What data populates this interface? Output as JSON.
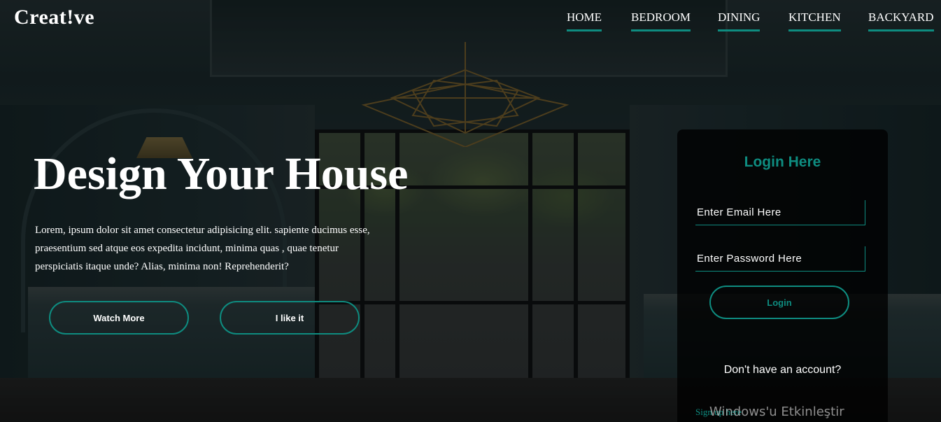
{
  "brand": "Creat!ve",
  "nav": {
    "items": [
      {
        "label": "HOME"
      },
      {
        "label": "BEDROOM"
      },
      {
        "label": "DINING"
      },
      {
        "label": "KITCHEN"
      },
      {
        "label": "BACKYARD"
      }
    ]
  },
  "hero": {
    "title": "Design Your House",
    "text": "Lorem, ipsum dolor sit amet consectetur adipisicing elit. sapiente ducimus esse, praesentium sed atque eos expedita incidunt, minima quas , quae tenetur perspiciatis itaque unde? Alias, minima non! Reprehenderit?",
    "buttons": {
      "watch_more": "Watch More",
      "like": "I like it"
    }
  },
  "login": {
    "title": "Login Here",
    "email_placeholder": "Enter Email Here",
    "password_placeholder": "Enter Password Here",
    "button": "Login",
    "question": "Don't have an account?",
    "signup": "Sign up here"
  },
  "os_watermark": "Windows'u Etkinleştir",
  "colors": {
    "accent": "#0e8c80",
    "text": "#ffffff",
    "card_bg": "#000000"
  },
  "icons": {
    "chandelier": "chandelier-decoration"
  }
}
